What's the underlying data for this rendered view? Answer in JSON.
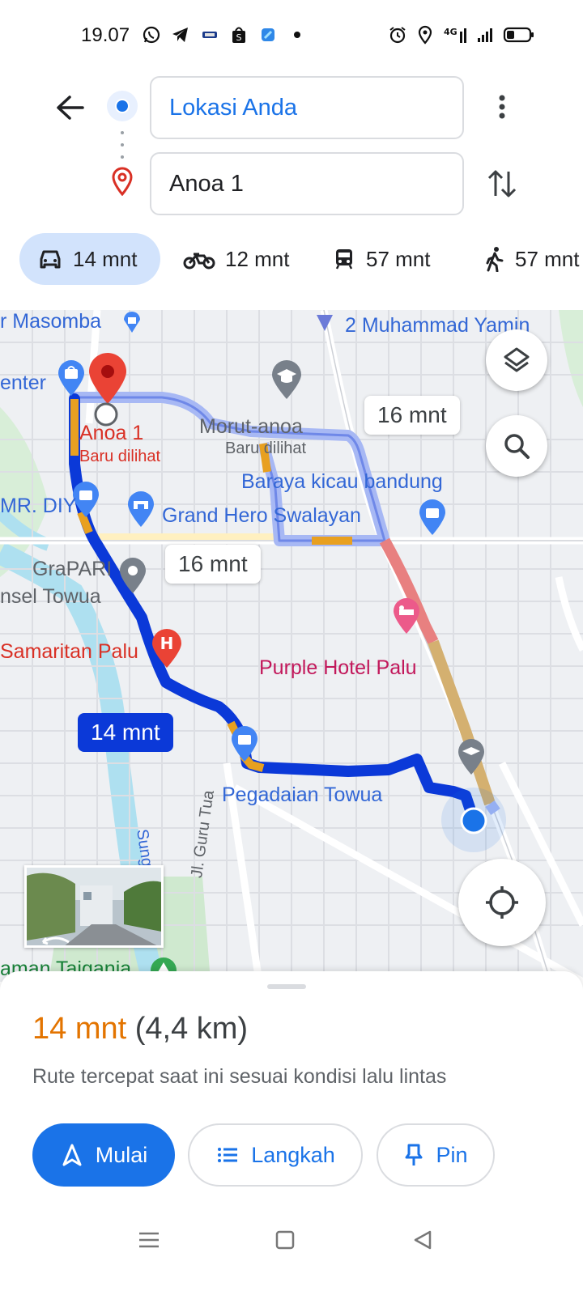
{
  "status_bar": {
    "time": "19.07",
    "left_icons": [
      "whatsapp-icon",
      "telegram-icon",
      "app-icon",
      "shopping-bag-icon",
      "app-icon",
      "dot-icon"
    ],
    "right_icons": [
      "alarm-icon",
      "location-icon",
      "4g-icon",
      "signal-icon",
      "battery-icon"
    ],
    "network_label": "4G"
  },
  "directions": {
    "origin_value": "Lokasi Anda",
    "destination_value": "Anoa 1"
  },
  "modes": [
    {
      "icon": "car-icon",
      "label": "14 mnt",
      "active": true
    },
    {
      "icon": "motorcycle-icon",
      "label": "12 mnt",
      "active": false
    },
    {
      "icon": "transit-icon",
      "label": "57 mnt",
      "active": false
    },
    {
      "icon": "walk-icon",
      "label": "57 mnt",
      "active": false
    }
  ],
  "map": {
    "labels": {
      "masomba": "r Masomba",
      "muhammad_yamin": "2 Muhammad Yamin",
      "center": "enter",
      "anoa": "Anoa 1",
      "baru_dilihat_1": "Baru dilihat",
      "morut_anoa": "Morut-anoa",
      "baru_dilihat_2": "Baru dilihat",
      "baraya": "Baraya kicau bandung",
      "mr_diy": "MR. DIY",
      "grand_hero": "Grand Hero Swalayan",
      "grapari": "GraPARI",
      "telkomsel": "nsel Towua",
      "samaritan": "Samaritan Palu",
      "purple_hotel": "Purple Hotel Palu",
      "pegadaian": "Pegadaian Towua",
      "guru_tua": "Jl. Guru Tua",
      "sungai": "Sung",
      "taman": "aman Taigania"
    },
    "eta_alt_1": "16 mnt",
    "eta_alt_2": "16 mnt",
    "eta_main": "14 mnt"
  },
  "route_summary": {
    "duration": "14 mnt",
    "distance": "(4,4 km)",
    "description": "Rute tercepat saat ini sesuai kondisi lalu lintas"
  },
  "actions": {
    "start": "Mulai",
    "steps": "Langkah",
    "pin": "Pin"
  },
  "colors": {
    "accent": "#1a73e8",
    "route_main": "#0b39d8",
    "route_alt": "#a7b8f4",
    "traffic_slow": "#e8a020",
    "traffic_heavy": "#e88080",
    "duration_orange": "#e37400"
  }
}
